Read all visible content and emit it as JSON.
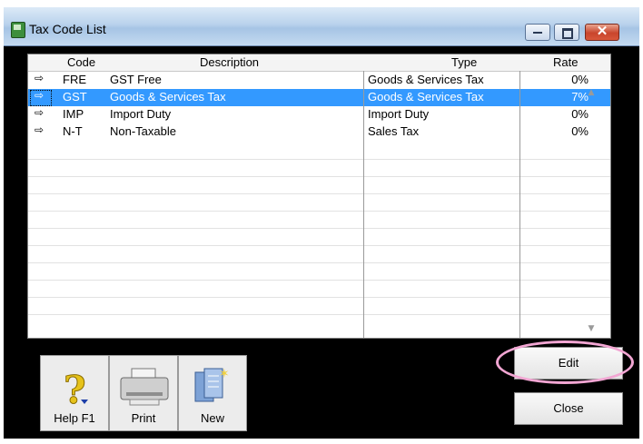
{
  "window": {
    "title": "Tax Code List",
    "controls": {
      "minimize": "minimize",
      "maximize": "maximize",
      "close": "✕"
    }
  },
  "table": {
    "columns": {
      "code": "Code",
      "description": "Description",
      "type": "Type",
      "rate": "Rate"
    },
    "rows": [
      {
        "code": "FRE",
        "description": "GST Free",
        "type": "Goods & Services Tax",
        "rate": "0%",
        "selected": false
      },
      {
        "code": "GST",
        "description": "Goods & Services Tax",
        "type": "Goods & Services Tax",
        "rate": "7%",
        "selected": true
      },
      {
        "code": "IMP",
        "description": "Import Duty",
        "type": "Import Duty",
        "rate": "0%",
        "selected": false
      },
      {
        "code": "N-T",
        "description": "Non-Taxable",
        "type": "Sales Tax",
        "rate": "0%",
        "selected": false
      }
    ],
    "arrow": "⇨"
  },
  "toolbar": {
    "help": "Help F1",
    "print": "Print",
    "new": "New"
  },
  "buttons": {
    "edit": "Edit",
    "close": "Close"
  },
  "colors": {
    "selection": "#3399ff",
    "highlight_ring": "#f2a6d3"
  }
}
